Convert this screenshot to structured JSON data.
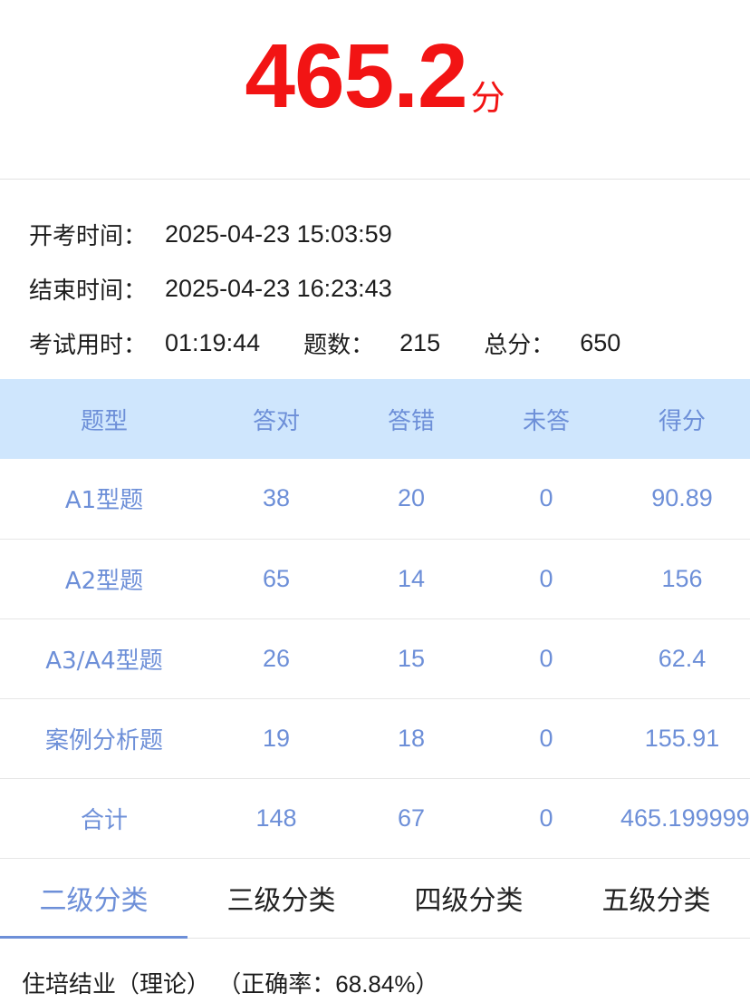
{
  "score": {
    "value": "465.2",
    "unit": "分"
  },
  "info": {
    "start": {
      "label": "开考时间：",
      "value": "2025-04-23 15:03:59"
    },
    "end": {
      "label": "结束时间：",
      "value": "2025-04-23 16:23:43"
    },
    "duration": {
      "label": "考试用时：",
      "value": "01:19:44"
    },
    "count": {
      "label": "题数：",
      "value": "215"
    },
    "total": {
      "label": "总分：",
      "value": "650"
    }
  },
  "table": {
    "headers": [
      "题型",
      "答对",
      "答错",
      "未答",
      "得分"
    ],
    "rows": [
      [
        "A1型题",
        "38",
        "20",
        "0",
        "90.89"
      ],
      [
        "A2型题",
        "65",
        "14",
        "0",
        "156"
      ],
      [
        "A3/A4型题",
        "26",
        "15",
        "0",
        "62.4"
      ],
      [
        "案例分析题",
        "19",
        "18",
        "0",
        "155.91"
      ],
      [
        "合计",
        "148",
        "67",
        "0",
        "465.199999"
      ]
    ]
  },
  "tabs": [
    "二级分类",
    "三级分类",
    "四级分类",
    "五级分类"
  ],
  "active_tab": 0,
  "category": {
    "name": "住培结业（理论）",
    "accuracy": "（正确率：68.84%）"
  },
  "colors": {
    "score": "#f21414",
    "accent": "#6d8fd8",
    "header_bg": "#cfe6fd"
  }
}
